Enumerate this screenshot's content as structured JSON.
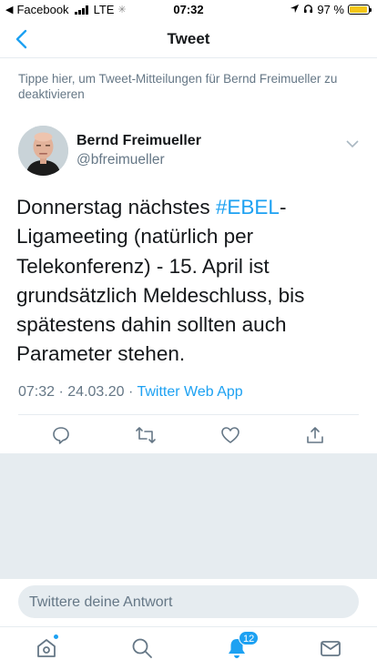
{
  "status_bar": {
    "back_app": "Facebook",
    "network": "LTE",
    "time": "07:32",
    "battery_percent": "97 %",
    "battery_level": 0.97
  },
  "nav": {
    "title": "Tweet"
  },
  "notice": {
    "text": "Tippe hier, um Tweet-Mitteilungen für Bernd Freimueller zu deaktivieren"
  },
  "tweet": {
    "author_name": "Bernd Freimueller",
    "author_handle": "@bfreimueller",
    "text_before": "Donnerstag nächstes ",
    "hashtag": "#EBEL",
    "text_after": "-Ligameeting (natürlich per Telekonferenz) - 15. April ist grundsätzlich Meldeschluss, bis spätestens dahin sollten auch Parameter stehen.",
    "time": "07:32",
    "date": "24.03.20",
    "source": "Twitter Web App",
    "separator": " · "
  },
  "actions": {
    "icons": [
      "reply-icon",
      "retweet-icon",
      "like-icon",
      "share-icon"
    ]
  },
  "reply": {
    "placeholder": "Twittere deine Antwort"
  },
  "tabbar": {
    "notifications_count": "12",
    "icons": [
      "home-icon",
      "search-icon",
      "notifications-icon",
      "messages-icon"
    ]
  },
  "colors": {
    "accent": "#1da1f2",
    "secondary_text": "#657786",
    "separator": "#e6ecf0",
    "battery": "#f5c518"
  }
}
